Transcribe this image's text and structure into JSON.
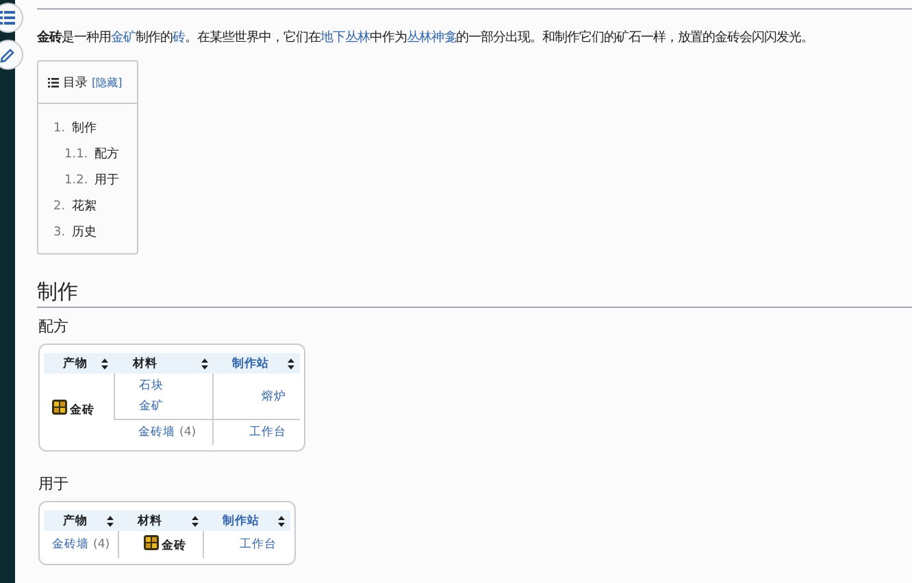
{
  "sidebar": {
    "buttons": [
      {
        "kind": "toc"
      },
      {
        "kind": "edit"
      }
    ]
  },
  "intro": [
    {
      "kind": "bold",
      "text": "金砖"
    },
    {
      "kind": "text",
      "text": "是一种用"
    },
    {
      "kind": "link",
      "text": "金矿"
    },
    {
      "kind": "text",
      "text": "制作的"
    },
    {
      "kind": "link",
      "text": "砖"
    },
    {
      "kind": "text",
      "text": "。在某些世界中，它们在"
    },
    {
      "kind": "link",
      "text": "地下丛林"
    },
    {
      "kind": "text",
      "text": "中作为"
    },
    {
      "kind": "link",
      "text": "丛林神龛"
    },
    {
      "kind": "text",
      "text": "的一部分出现。和制作它们的矿石一样，放置的金砖会闪闪发光。"
    }
  ],
  "toc": {
    "title": "目录",
    "toggle": "[隐藏]",
    "items": [
      {
        "number": "1.",
        "label": "制作",
        "children": [
          {
            "number": "1.1.",
            "label": "配方"
          },
          {
            "number": "1.2.",
            "label": "用于"
          }
        ]
      },
      {
        "number": "2.",
        "label": "花絮"
      },
      {
        "number": "3.",
        "label": "历史"
      }
    ]
  },
  "section": {
    "heading": "制作",
    "subsections": [
      {
        "heading": "配方",
        "columns": [
          {
            "label": "产物",
            "kind": "text"
          },
          {
            "label": "材料",
            "kind": "text"
          },
          {
            "label": "制作站",
            "kind": "link"
          }
        ],
        "groups": [
          {
            "product": {
              "kind": "current",
              "name": "金砖"
            },
            "recipes": [
              {
                "ingredients": [
                  {
                    "kind": "link",
                    "name": "石块"
                  },
                  {
                    "kind": "link",
                    "name": "金矿"
                  }
                ],
                "station": "熔炉"
              },
              {
                "ingredients": [
                  {
                    "kind": "link",
                    "name": "金砖墙",
                    "count": "(4)"
                  }
                ],
                "station": "工作台"
              }
            ]
          }
        ]
      },
      {
        "heading": "用于",
        "columns": [
          {
            "label": "产物",
            "kind": "text"
          },
          {
            "label": "材料",
            "kind": "text"
          },
          {
            "label": "制作站",
            "kind": "link"
          }
        ],
        "groups": [
          {
            "product": {
              "kind": "link",
              "name": "金砖墙",
              "count": "(4)"
            },
            "recipes": [
              {
                "ingredients": [
                  {
                    "kind": "current",
                    "name": "金砖"
                  }
                ],
                "station": "工作台"
              }
            ]
          }
        ]
      }
    ]
  }
}
